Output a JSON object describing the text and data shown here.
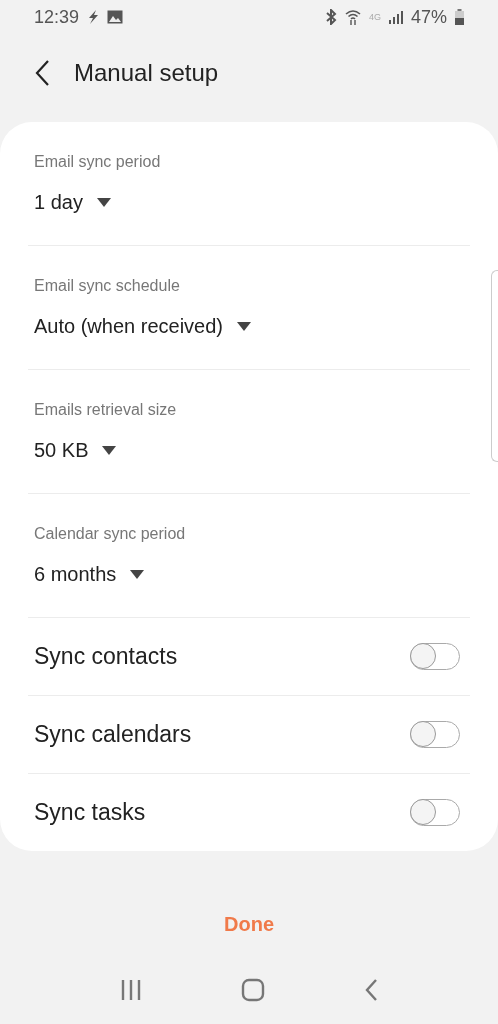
{
  "status_bar": {
    "time": "12:39",
    "network": "4G",
    "battery": "47%"
  },
  "header": {
    "title": "Manual setup"
  },
  "settings": [
    {
      "kind": "dropdown",
      "label": "Email sync period",
      "value": "1 day"
    },
    {
      "kind": "dropdown",
      "label": "Email sync schedule",
      "value": "Auto (when received)"
    },
    {
      "kind": "dropdown",
      "label": "Emails retrieval size",
      "value": "50 KB"
    },
    {
      "kind": "dropdown",
      "label": "Calendar sync period",
      "value": "6 months"
    },
    {
      "kind": "toggle",
      "label": "Sync contacts",
      "on": false
    },
    {
      "kind": "toggle",
      "label": "Sync calendars",
      "on": false
    },
    {
      "kind": "toggle",
      "label": "Sync tasks",
      "on": false
    }
  ],
  "done_button": "Done"
}
